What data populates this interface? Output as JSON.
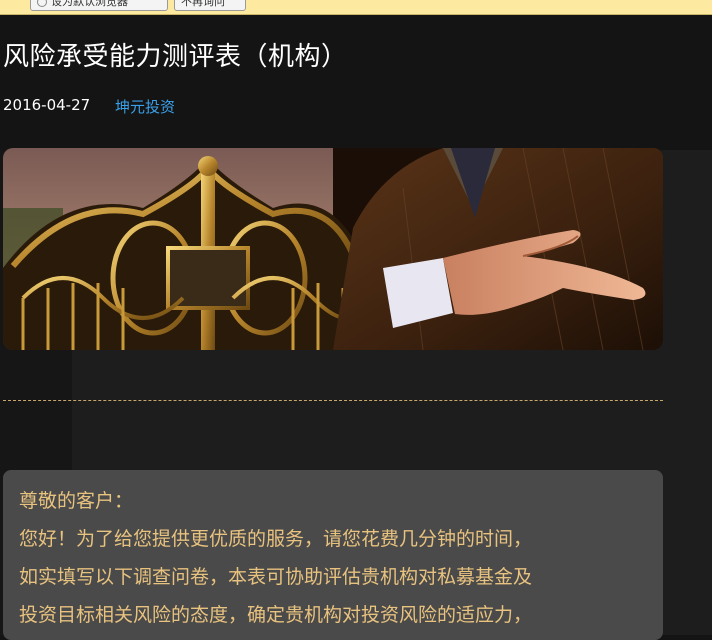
{
  "browser_bar": {
    "button1_label": "设为默认浏览器",
    "button2_label": "不再询问"
  },
  "article": {
    "title": "风险承受能力测评表（机构）",
    "date": "2016-04-27",
    "author": "坤元投资"
  },
  "letter": {
    "greeting": "尊敬的客户：",
    "lines": [
      "您好！为了给您提供更优质的服务，请您花费几分钟的时间，",
      "如实填写以下调查问卷，本表可协助评估贵机构对私募基金及",
      "投资目标相关风险的态度，确定贵机构对投资风险的适应力，"
    ]
  },
  "colors": {
    "background": "#141414",
    "link": "#3aa0e8",
    "letter_text": "#e8c27f",
    "divider": "#c8a86a"
  }
}
